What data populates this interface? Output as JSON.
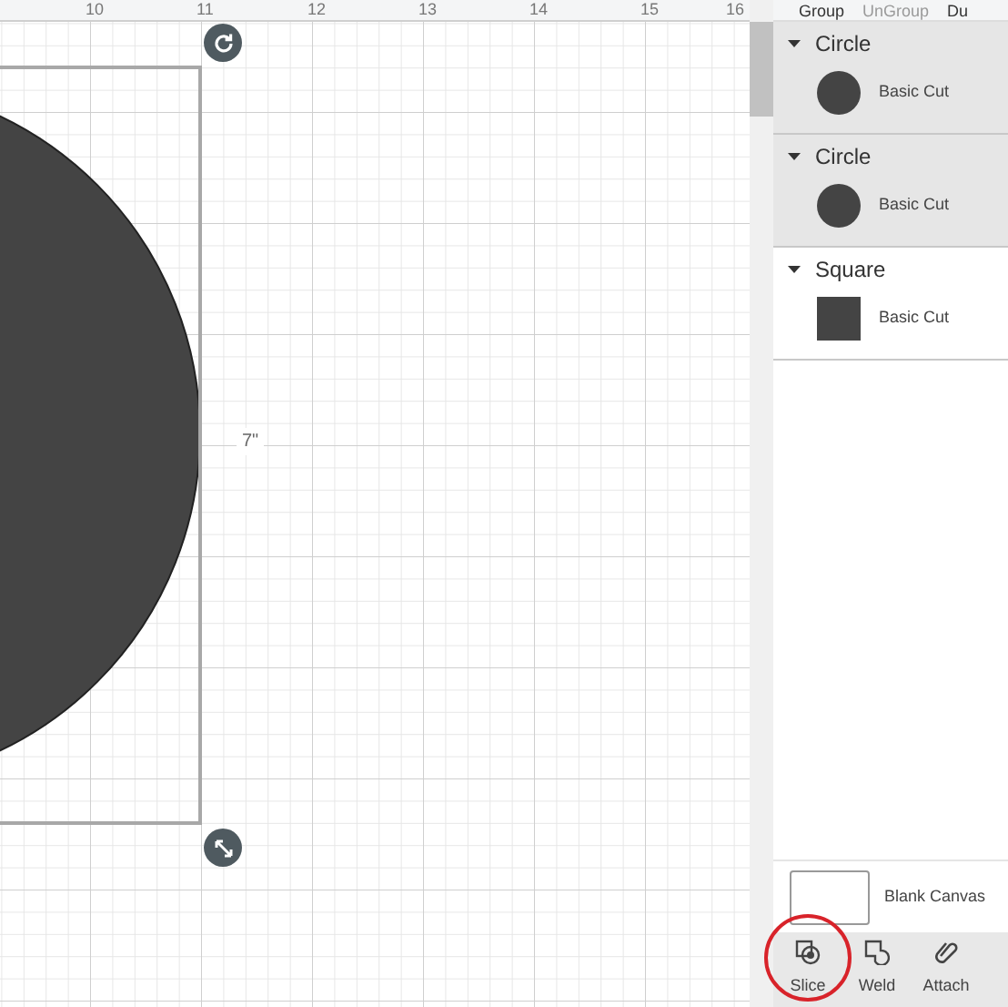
{
  "ruler": {
    "labels": [
      "10",
      "11",
      "12",
      "13",
      "14",
      "15",
      "16"
    ]
  },
  "canvas": {
    "dimension_label": "7\""
  },
  "toolbar": [
    {
      "label": "Group",
      "disabled": false
    },
    {
      "label": "UnGroup",
      "disabled": true
    },
    {
      "label": "Du",
      "disabled": false
    }
  ],
  "layers": [
    {
      "name": "Circle",
      "kind": "circle",
      "operation": "Basic Cut",
      "selected": true
    },
    {
      "name": "Circle",
      "kind": "circle",
      "operation": "Basic Cut",
      "selected": true
    },
    {
      "name": "Square",
      "kind": "square",
      "operation": "Basic Cut",
      "selected": false
    }
  ],
  "blank_canvas": {
    "label": "Blank Canvas"
  },
  "actions": [
    {
      "label": "Slice",
      "kind": "slice",
      "highlighted": true
    },
    {
      "label": "Weld",
      "kind": "weld",
      "highlighted": false
    },
    {
      "label": "Attach",
      "kind": "attach",
      "highlighted": false
    }
  ]
}
